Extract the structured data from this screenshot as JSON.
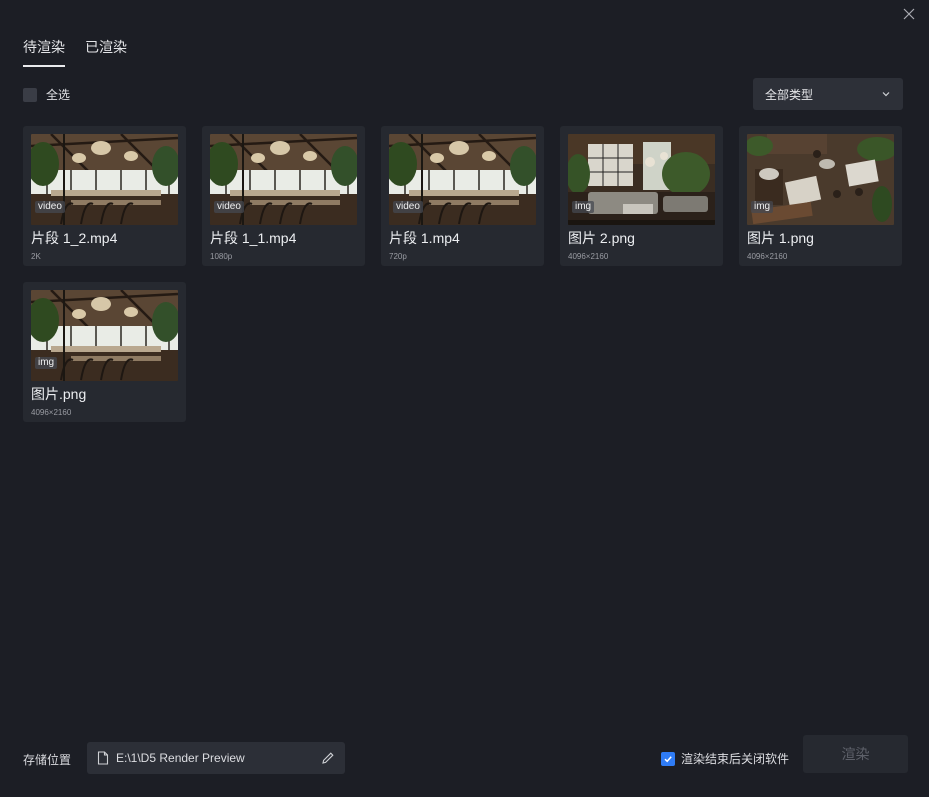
{
  "tabs": [
    {
      "label": "待渲染",
      "active": true
    },
    {
      "label": "已渲染",
      "active": false
    }
  ],
  "select_all_label": "全选",
  "type_filter": {
    "selected": "全部类型"
  },
  "items": [
    {
      "title": "片段 1_2.mp4",
      "meta": "2K",
      "badge": "video",
      "scene": "restaurant"
    },
    {
      "title": "片段 1_1.mp4",
      "meta": "1080p",
      "badge": "video",
      "scene": "restaurant"
    },
    {
      "title": "片段 1.mp4",
      "meta": "720p",
      "badge": "video",
      "scene": "restaurant"
    },
    {
      "title": "图片 2.png",
      "meta": "4096×2160",
      "badge": "img",
      "scene": "lounge"
    },
    {
      "title": "图片 1.png",
      "meta": "4096×2160",
      "badge": "img",
      "scene": "topdown"
    },
    {
      "title": "图片.png",
      "meta": "4096×2160",
      "badge": "img",
      "scene": "restaurant"
    }
  ],
  "footer": {
    "storage_label": "存储位置",
    "path": "E:\\1\\D5 Render Preview",
    "close_after_label": "渲染结束后关闭软件",
    "close_after_checked": true,
    "render_button": "渲染"
  },
  "colors": {
    "accent": "#2f7cf6",
    "background": "#1c1e25",
    "card": "#262930"
  }
}
